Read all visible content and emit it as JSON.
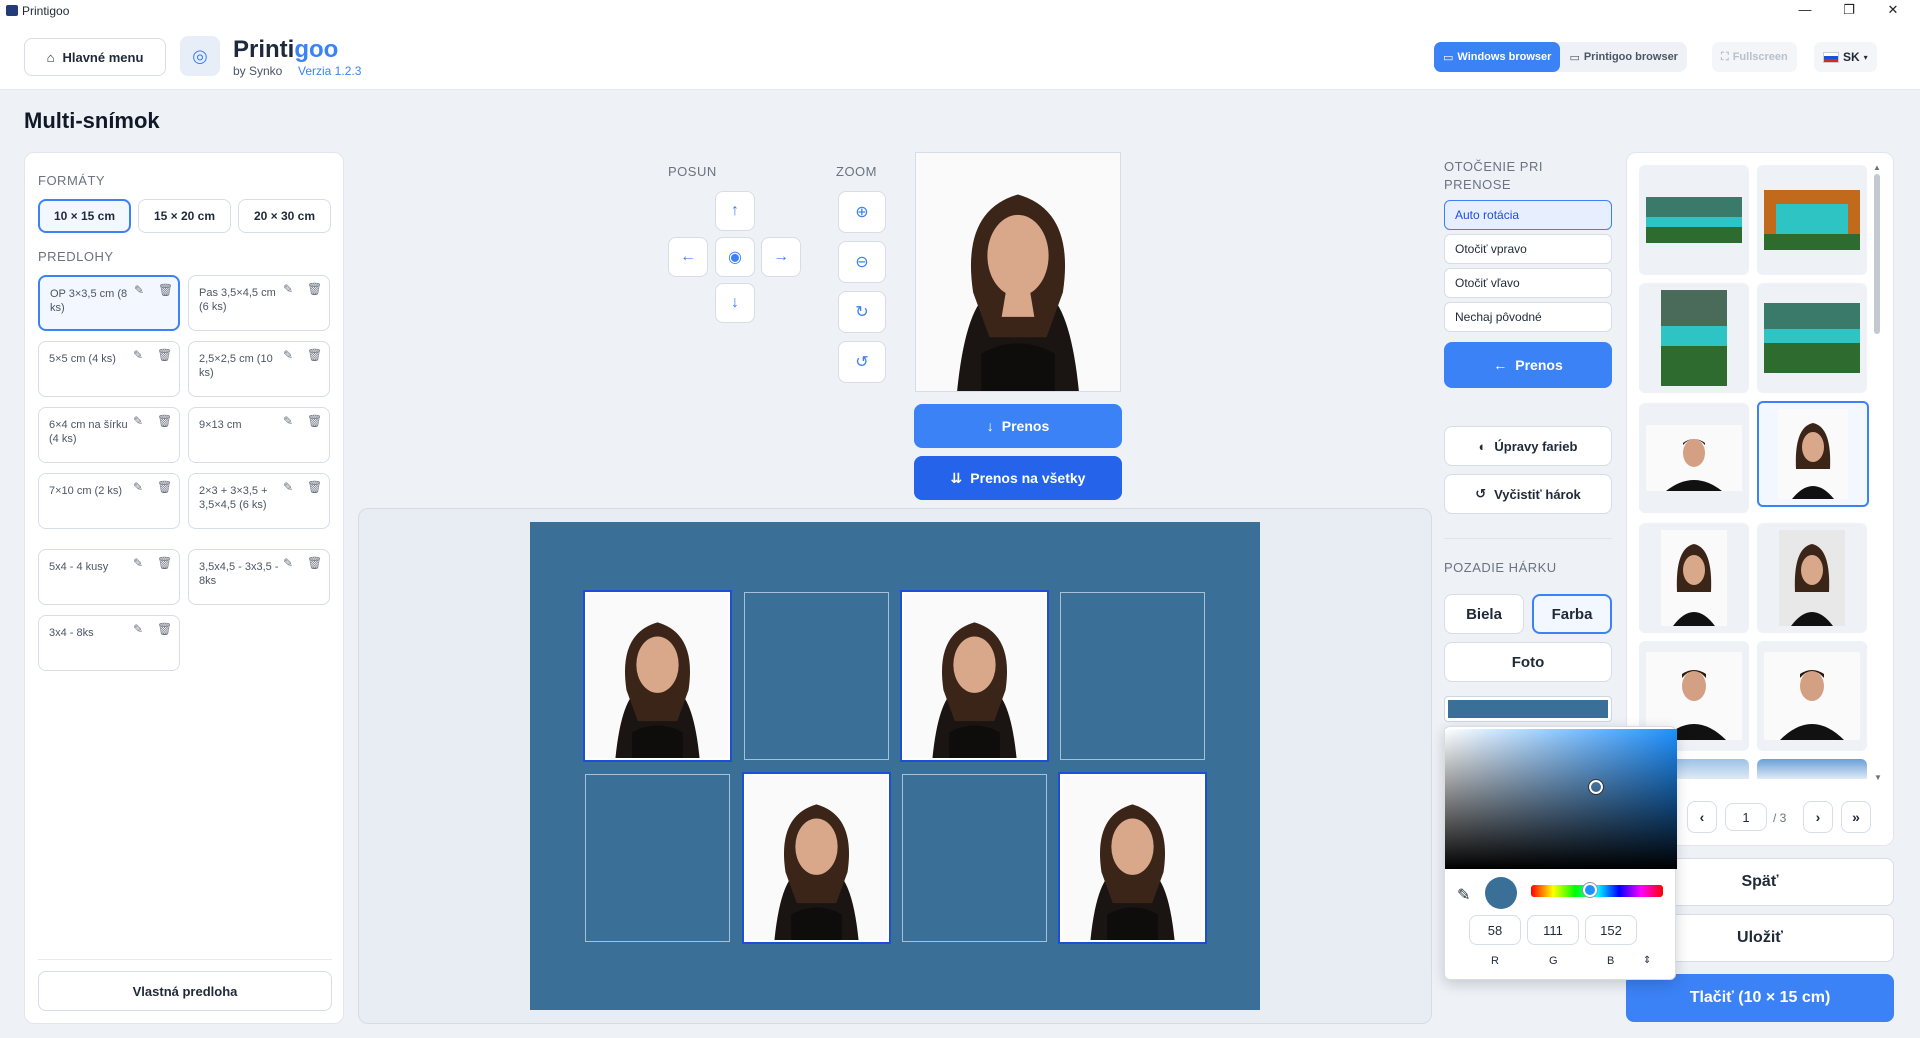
{
  "window": {
    "title": "Printigoo",
    "min": "—",
    "max": "❐",
    "close": "✕"
  },
  "header": {
    "home_label": "Hlavné menu",
    "logo_main": "Printi",
    "logo_accent": "goo",
    "byline": "by Synko",
    "version": "Verzia 1.2.3",
    "windows_browser": "Windows browser",
    "printigoo_browser": "Printigoo browser",
    "fullscreen": "Fullscreen",
    "lang": "SK"
  },
  "page": {
    "title": "Multi-snímok"
  },
  "left": {
    "formats_label": "FORMÁTY",
    "formats": [
      "10 × 15 cm",
      "15 × 20 cm",
      "20 × 30 cm"
    ],
    "templates_label": "PREDLOHY",
    "templates": [
      "OP 3×3,5 cm (8 ks)",
      "Pas 3,5×4,5 cm (6 ks)",
      "5×5 cm (4 ks)",
      "2,5×2,5 cm (10 ks)",
      "6×4 cm na šírku (4 ks)",
      "9×13 cm",
      "7×10 cm (2 ks)",
      "2×3 + 3×3,5 + 3,5×4,5 (6 ks)",
      "5x4 - 4 kusy",
      "3,5x4,5 - 3x3,5 - 8ks",
      "3x4 - 8ks"
    ],
    "custom_template": "Vlastná predloha"
  },
  "controls": {
    "posun_label": "POSUN",
    "zoom_label": "ZOOM",
    "prenos": "Prenos",
    "prenos_all": "Prenos na všetky"
  },
  "right": {
    "rotation_label": "OTOČENIE PRI PRENOSE",
    "rotations": [
      "Auto rotácia",
      "Otočiť vpravo",
      "Otočiť vľavo",
      "Nechaj pôvodné"
    ],
    "prenos": "Prenos",
    "color_adjust": "Úpravy farieb",
    "clear_sheet": "Vyčistiť hárok",
    "bg_label": "POZADIE HÁRKU",
    "bg_white": "Biela",
    "bg_color": "Farba",
    "bg_photo": "Foto",
    "sheet_color": "#3a6f98"
  },
  "color_picker": {
    "r": "58",
    "g": "111",
    "b": "152",
    "r_label": "R",
    "g_label": "G",
    "b_label": "B"
  },
  "gallery": {
    "page": "1",
    "pages": "/ 3",
    "prev": "‹",
    "next": "›",
    "last": "»"
  },
  "actions": {
    "back": "Späť",
    "save": "Uložiť",
    "print": "Tlačiť (10 × 15 cm)"
  }
}
